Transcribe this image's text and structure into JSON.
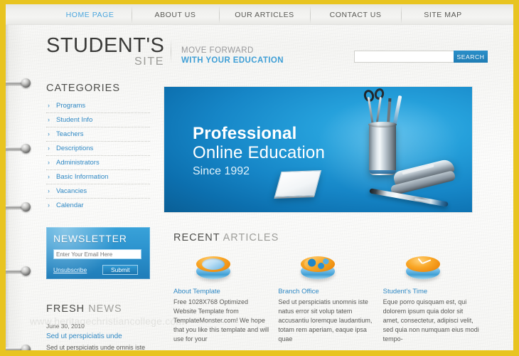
{
  "theme": {
    "frame_color": "#e8c420",
    "accent_blue": "#2f88c4",
    "nav_active": "#4ba6de",
    "banner_blue": "#1686c7"
  },
  "nav": {
    "items": [
      {
        "label": "HOME PAGE",
        "active": true
      },
      {
        "label": "ABOUT US",
        "active": false
      },
      {
        "label": "OUR ARTICLES",
        "active": false
      },
      {
        "label": "CONTACT US",
        "active": false
      },
      {
        "label": "SITE MAP",
        "active": false
      }
    ]
  },
  "header": {
    "logo_line1": "STUDENT'S",
    "logo_line2": "SITE",
    "tagline_line1": "MOVE FORWARD",
    "tagline_line2": "WITH YOUR EDUCATION"
  },
  "search": {
    "value": "",
    "placeholder": "",
    "button_label": "SEARCH"
  },
  "sidebar": {
    "categories_title": "CATEGORIES",
    "categories": [
      {
        "label": "Programs"
      },
      {
        "label": "Student Info"
      },
      {
        "label": "Teachers"
      },
      {
        "label": "Descriptions"
      },
      {
        "label": "Administrators"
      },
      {
        "label": "Basic Information"
      },
      {
        "label": "Vacancies"
      },
      {
        "label": "Calendar"
      }
    ],
    "newsletter": {
      "title": "NEWSLETTER",
      "email_value": "",
      "email_placeholder": "Enter Your Email Here",
      "unsubscribe_label": "Unsubscribe",
      "submit_label": "Submit"
    },
    "fresh_news": {
      "title_bold": "FRESH",
      "title_light": "NEWS",
      "date": "June 30, 2010",
      "link": "Sed ut perspiciatis unde",
      "body": "Sed ut perspiciatis unde omnis iste"
    }
  },
  "watermark": "www.heritagechristiancollege.com",
  "banner": {
    "line1": "Professional",
    "line2": "Online Education",
    "line3": "Since 1992"
  },
  "recent": {
    "title_bold": "RECENT",
    "title_light": "ARTICLES",
    "articles": [
      {
        "icon": "lens-disc-icon",
        "title": "About Template",
        "body": "Free 1028X768 Optimized Website Template from TemplateMonster.com! We hope that you like this template and will use for your"
      },
      {
        "icon": "globe-disc-icon",
        "title": "Branch Office",
        "body": "Sed ut perspiciatis unomnis iste natus error sit volup tatem accusantiu loremque laudantium, totam rem aperiam, eaque ipsa quae"
      },
      {
        "icon": "clock-disc-icon",
        "title": "Student's Time",
        "body": "Eque porro quisquam est, qui dolorem ipsum quia dolor sit amet, consectetur, adipisci velit, sed quia non numquam eius modi tempo-"
      }
    ]
  }
}
